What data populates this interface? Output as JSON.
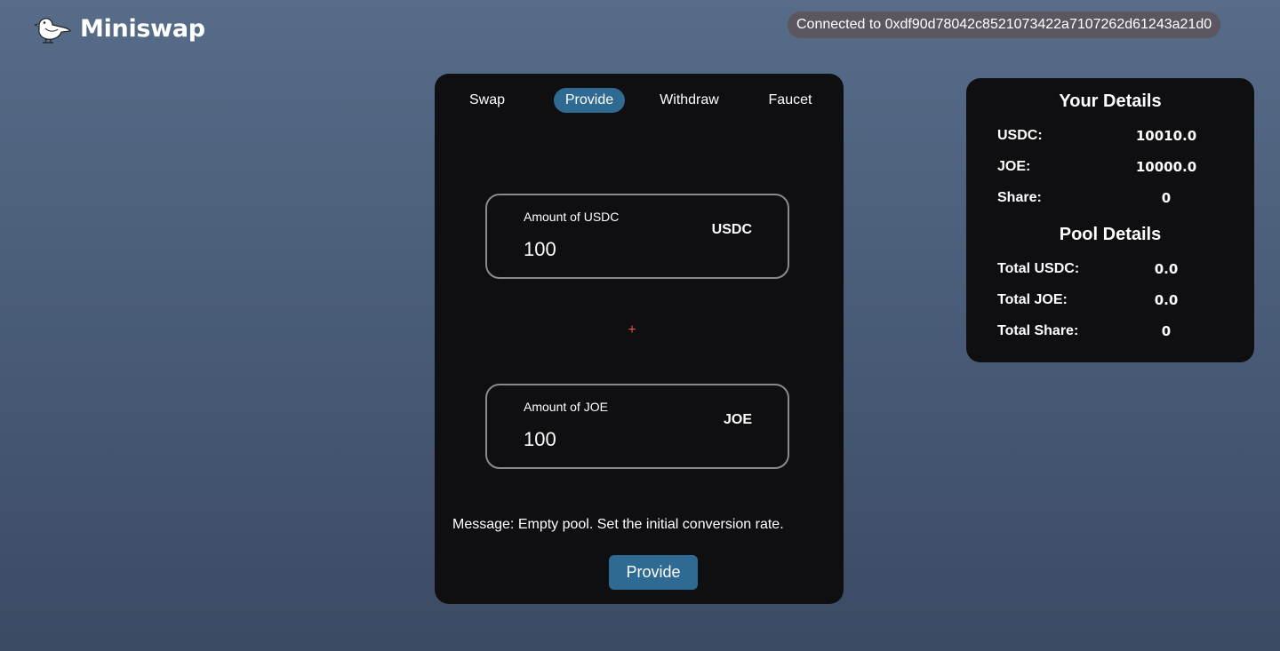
{
  "header": {
    "brand_name": "Miniswap",
    "logo_icon": "bird-logo-icon",
    "connection_text": "Connected to 0xdf90d78042c8521073422a7107262d61243a21d0"
  },
  "tabs": [
    {
      "label": "Swap",
      "active": false
    },
    {
      "label": "Provide",
      "active": true
    },
    {
      "label": "Withdraw",
      "active": false
    },
    {
      "label": "Faucet",
      "active": false
    }
  ],
  "provide_form": {
    "usdc_field": {
      "label": "Amount of USDC",
      "value": "100",
      "token": "USDC"
    },
    "plus_symbol": "+",
    "joe_field": {
      "label": "Amount of JOE",
      "value": "100",
      "token": "JOE"
    },
    "message": "Message: Empty pool. Set the initial conversion rate.",
    "submit_label": "Provide"
  },
  "your_details": {
    "heading": "Your Details",
    "rows": [
      {
        "label": "USDC:",
        "value": "10010.0"
      },
      {
        "label": "JOE:",
        "value": "10000.0"
      },
      {
        "label": "Share:",
        "value": "0"
      }
    ]
  },
  "pool_details": {
    "heading": "Pool Details",
    "rows": [
      {
        "label": "Total USDC:",
        "value": "0.0"
      },
      {
        "label": "Total JOE:",
        "value": "0.0"
      },
      {
        "label": "Total Share:",
        "value": "0"
      }
    ]
  },
  "colors": {
    "accent": "#2f6a93",
    "panel": "#0f0f11",
    "plus": "#e0524e",
    "connection_pill": "#5c5660"
  }
}
